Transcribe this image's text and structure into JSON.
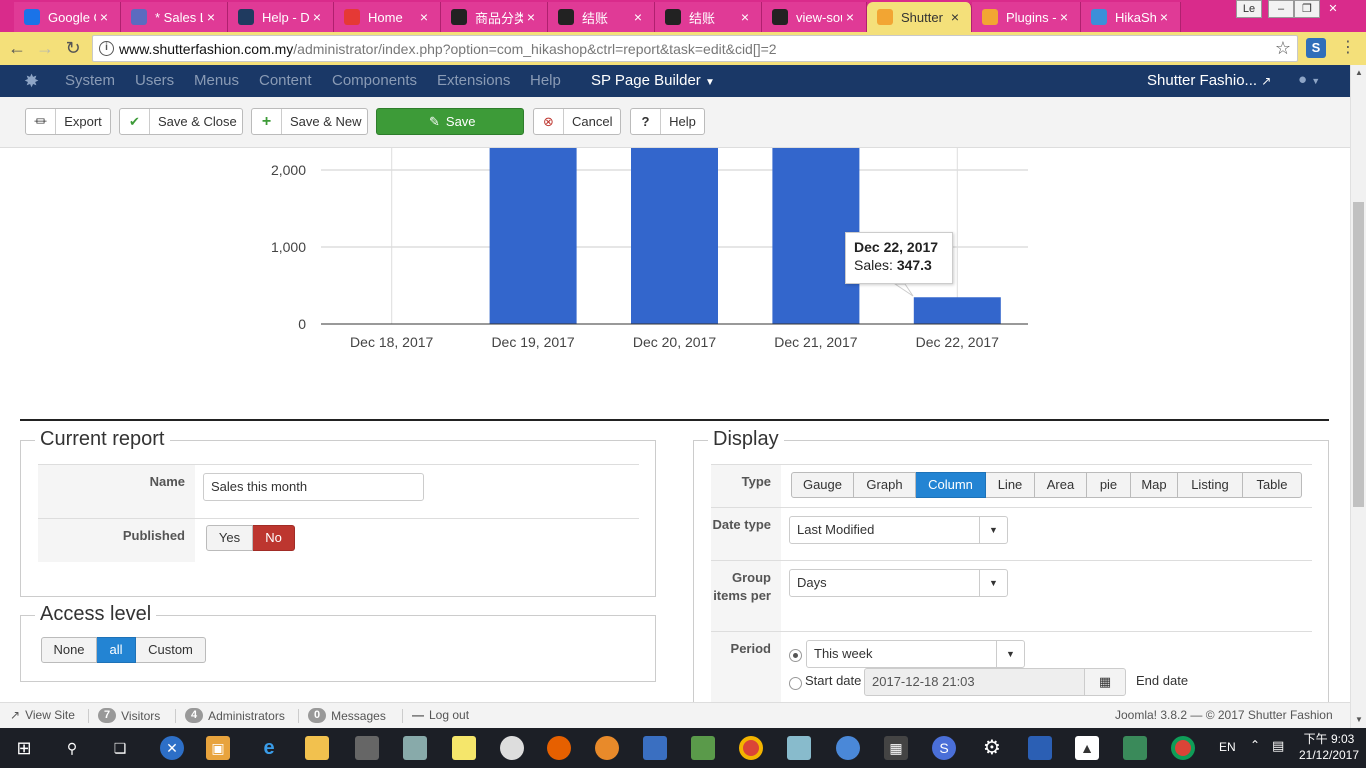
{
  "browser": {
    "tabs": [
      {
        "label": "Google C",
        "color": "#1a73e8",
        "active": false
      },
      {
        "label": "* Sales L",
        "color": "#5b6bc0",
        "active": false
      },
      {
        "label": "Help - D",
        "color": "#1f3a5f",
        "active": false
      },
      {
        "label": "Home",
        "color": "#e53935",
        "active": false
      },
      {
        "label": "商品分类",
        "color": "#222222",
        "active": false
      },
      {
        "label": "结账",
        "color": "#222222",
        "active": false
      },
      {
        "label": "结账",
        "color": "#222222",
        "active": false
      },
      {
        "label": "view-sou",
        "color": "#222222",
        "active": false
      },
      {
        "label": "Shutter F",
        "color": "#f2a533",
        "active": true
      },
      {
        "label": "Plugins -",
        "color": "#f2a533",
        "active": false
      },
      {
        "label": "HikaSho",
        "color": "#3b8fd9",
        "active": false
      }
    ],
    "url_host": "www.shutterfashion.com.my",
    "url_path": "/administrator/index.php?option=com_hikashop&ctrl=report&task=edit&cid[]=2"
  },
  "joomla_nav": {
    "menus": [
      "System",
      "Users",
      "Menus",
      "Content",
      "Components",
      "Extensions",
      "Help"
    ],
    "page_builder": "SP Page Builder",
    "site_name": "Shutter Fashio..."
  },
  "toolbar": {
    "export": "Export",
    "save_close": "Save & Close",
    "save_new": "Save & New",
    "save": "Save",
    "cancel": "Cancel",
    "help": "Help"
  },
  "chart_data": {
    "type": "bar",
    "categories": [
      "Dec 18, 2017",
      "Dec 19, 2017",
      "Dec 20, 2017",
      "Dec 21, 2017",
      "Dec 22, 2017"
    ],
    "series": [
      {
        "name": "Sales",
        "values": [
          0,
          2300,
          2300,
          2300,
          347.3
        ]
      }
    ],
    "y_ticks": [
      "0",
      "1,000",
      "2,000"
    ],
    "color": "#3366cc",
    "tooltip": {
      "date": "Dec 22, 2017",
      "label": "Sales:",
      "value": "347.3"
    }
  },
  "current_report": {
    "legend": "Current report",
    "name_label": "Name",
    "name_value": "Sales this month",
    "published_label": "Published",
    "yes": "Yes",
    "no": "No"
  },
  "access_level": {
    "legend": "Access level",
    "options": [
      "None",
      "all",
      "Custom"
    ],
    "selected": "all"
  },
  "display": {
    "legend": "Display",
    "type_label": "Type",
    "types": [
      "Gauge",
      "Graph",
      "Column",
      "Line",
      "Area",
      "pie",
      "Map",
      "Listing",
      "Table"
    ],
    "selected_type": "Column",
    "date_type_label": "Date type",
    "date_type_value": "Last Modified",
    "group_label": "Group items per",
    "group_value": "Days",
    "period_label": "Period",
    "period_value": "This week",
    "start_date_label": "Start date",
    "start_date_value": "2017-12-18 21:03",
    "end_date_label": "End date"
  },
  "statusbar": {
    "view_site": "View Site",
    "visitors_count": "7",
    "visitors": "Visitors",
    "admins_count": "4",
    "admins": "Administrators",
    "messages_count": "0",
    "messages": "Messages",
    "logout": "Log out",
    "version": "Joomla! 3.8.2  —  © 2017 Shutter Fashion"
  },
  "taskbar": {
    "lang": "EN",
    "time": "下午 9:03",
    "date": "21/12/2017"
  }
}
